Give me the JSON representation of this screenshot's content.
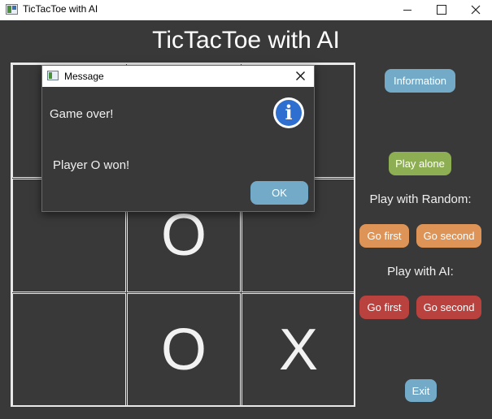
{
  "window": {
    "title": "TicTacToe with AI",
    "icons": {
      "app": "window-app-icon",
      "minimize": "minimize-icon",
      "maximize": "maximize-icon",
      "close": "close-icon"
    }
  },
  "main": {
    "title": "TicTacToe with AI"
  },
  "board": {
    "cells": [
      "",
      "",
      "",
      "",
      "O",
      "",
      "",
      "O",
      "X"
    ]
  },
  "sidebar": {
    "information_label": "Information",
    "play_alone_label": "Play alone",
    "random_heading": "Play with Random:",
    "random_go_first": "Go first",
    "random_go_second": "Go second",
    "ai_heading": "Play with AI:",
    "ai_go_first": "Go first",
    "ai_go_second": "Go second",
    "exit_label": "Exit"
  },
  "dialog": {
    "title": "Message",
    "line1": "Game over!",
    "line2": "Player O won!",
    "icon": "information-icon",
    "ok_label": "OK"
  },
  "colors": {
    "background": "#393939",
    "blue_button": "#73aac8",
    "green_button": "#8eae54",
    "orange_button": "#de9456",
    "red_button": "#b9413e"
  }
}
